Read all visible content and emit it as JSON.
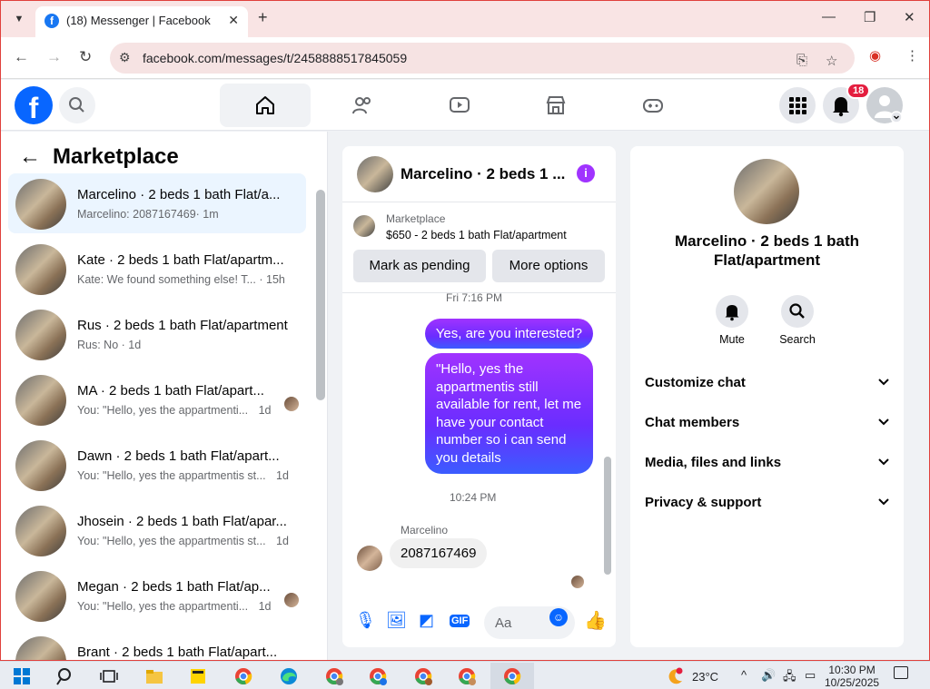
{
  "browser": {
    "tab_title": "(18) Messenger | Facebook",
    "url": "facebook.com/messages/t/2458888517845059"
  },
  "header": {
    "notification_count": "18"
  },
  "left_panel": {
    "title": "Marketplace",
    "conversations": [
      {
        "name": "Marcelino · 2 beds 1 bath Flat/a...",
        "preview": "Marcelino: 2087167469",
        "time": "· 1m"
      },
      {
        "name": "Kate · 2 beds 1 bath Flat/apartm...",
        "preview": "Kate: We found something else! T...",
        "time": "· 15h"
      },
      {
        "name": "Rus · 2 beds 1 bath Flat/apartment",
        "preview": "Rus: No",
        "time": "· 1d"
      },
      {
        "name": "MA · 2 beds 1 bath Flat/apart...",
        "preview": "You: \"Hello, yes the appartmenti...",
        "time": "1d"
      },
      {
        "name": "Dawn · 2 beds 1 bath Flat/apart...",
        "preview": "You: \"Hello, yes the appartmentis st...",
        "time": "1d"
      },
      {
        "name": "Jhosein · 2 beds 1 bath Flat/apar...",
        "preview": "You: \"Hello, yes the appartmentis st...",
        "time": "1d"
      },
      {
        "name": "Megan · 2 beds 1 bath Flat/ap...",
        "preview": "You: \"Hello, yes the appartmenti...",
        "time": "1d"
      },
      {
        "name": "Brant · 2 beds 1 bath Flat/apart...",
        "preview": "",
        "time": ""
      }
    ]
  },
  "chat": {
    "title": "Marcelino · 2 beds 1 ...",
    "marketplace_label": "Marketplace",
    "listing": "$650 - 2 beds 1 bath Flat/apartment",
    "pending_button": "Mark as pending",
    "more_button": "More options",
    "timestamp_1": "Fri 7:16 PM",
    "out_msg_1": "Yes, are you interested?",
    "out_msg_2": "\"Hello, yes the appartmentis still available for rent, let me have your contact number so i can send you details",
    "timestamp_2": "10:24 PM",
    "sender_name": "Marcelino",
    "in_msg_1": "2087167469",
    "composer_placeholder": "Aa"
  },
  "right_panel": {
    "name": "Marcelino · 2 beds 1 bath Flat/apartment",
    "mute_label": "Mute",
    "search_label": "Search",
    "sections": [
      "Customize chat",
      "Chat members",
      "Media, files and links",
      "Privacy & support"
    ]
  },
  "taskbar": {
    "temperature": "23°C",
    "time": "10:30 PM",
    "date": "10/25/2025"
  }
}
